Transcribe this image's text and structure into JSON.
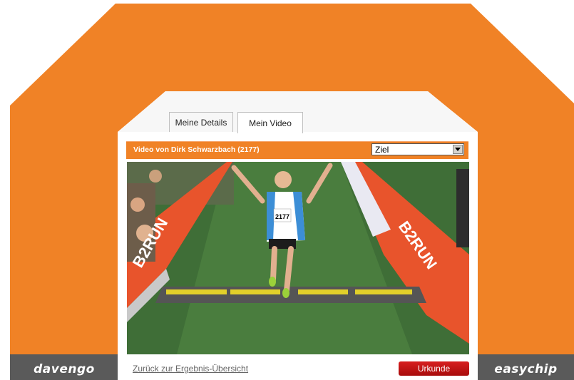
{
  "brands": {
    "left": "davengo",
    "right": "easychip"
  },
  "tabs": [
    {
      "label": "Meine Details",
      "active": false
    },
    {
      "label": "Mein Video",
      "active": true
    }
  ],
  "video_panel": {
    "title": "Video von Dirk Schwarzbach (2177)",
    "select": {
      "selected": "Ziel"
    }
  },
  "scene": {
    "bib_number": "2177",
    "sponsor_text": "B2RUN"
  },
  "footer": {
    "back_link": "Zurück zur Ergebnis-Übersicht",
    "certificate_button": "Urkunde"
  },
  "colors": {
    "accent_orange": "#f08226",
    "brand_bar": "#5a5a5a",
    "button_red": "#c01010"
  }
}
